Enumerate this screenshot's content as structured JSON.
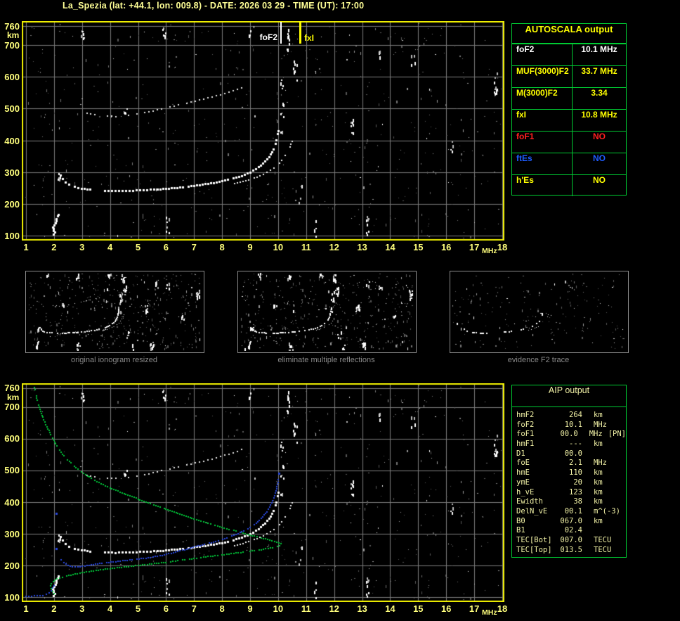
{
  "header": {
    "title": "La_Spezia (lat: +44.1, lon: 009.8) - DATE: 2026 03 29 - TIME (UT): 17:00"
  },
  "colors": {
    "background": "#000000",
    "title_text": "#ffff96",
    "axis_label": "#ffff7d",
    "plot_border": "#f0f000",
    "grid": "#7b7b7b",
    "trace_white": "#ffffff",
    "trace_blue": "#2848e0",
    "trace_green": "#00c838",
    "table_border": "#00cc33",
    "thumb_border": "#8c8c8c",
    "caption_text": "#8a8a8a",
    "yellow": "#ffff00",
    "white": "#ffffff",
    "red": "#ff2020",
    "status_blue": "#1e5cff",
    "aip_text": "#f2f2a6",
    "marker_fof2": "#ffffff",
    "marker_fxi": "#ffff00"
  },
  "autoscala": {
    "title": "AUTOSCALA output",
    "rows": [
      {
        "label": "foF2",
        "value": "10.1 MHz",
        "color": "#ffffff"
      },
      {
        "label": "MUF(3000)F2",
        "value": "33.7 MHz",
        "color": "#ffff00"
      },
      {
        "label": "M(3000)F2",
        "value": "3.34",
        "color": "#ffff00"
      },
      {
        "label": "fxI",
        "value": "10.8 MHz",
        "color": "#ffff00"
      },
      {
        "label": "foF1",
        "value": "NO",
        "color": "#ff2020"
      },
      {
        "label": "ftEs",
        "value": "NO",
        "color": "#1e5cff"
      },
      {
        "label": "h'Es",
        "value": "NO",
        "color": "#ffff00"
      }
    ]
  },
  "aip": {
    "title": "AIP output",
    "rows": [
      {
        "label": "hmF2",
        "value": "264",
        "unit": "km",
        "note": ""
      },
      {
        "label": "foF2",
        "value": "10.1",
        "unit": "MHz",
        "note": ""
      },
      {
        "label": "foF1",
        "value": "00.0",
        "unit": "MHz",
        "note": "[PN]"
      },
      {
        "label": "hmF1",
        "value": "---",
        "unit": "km",
        "note": ""
      },
      {
        "label": "D1",
        "value": "00.0",
        "unit": "",
        "note": ""
      },
      {
        "label": "foE",
        "value": "2.1",
        "unit": "MHz",
        "note": ""
      },
      {
        "label": "hmE",
        "value": "110",
        "unit": "km",
        "note": ""
      },
      {
        "label": "ymE",
        "value": "20",
        "unit": "km",
        "note": ""
      },
      {
        "label": "h_vE",
        "value": "123",
        "unit": "km",
        "note": ""
      },
      {
        "label": "Ewidth",
        "value": "38",
        "unit": "km",
        "note": ""
      },
      {
        "label": "DelN_vE",
        "value": "00.1",
        "unit": "m^(-3)",
        "note": ""
      },
      {
        "label": "B0",
        "value": "067.0",
        "unit": "km",
        "note": ""
      },
      {
        "label": "B1",
        "value": "02.4",
        "unit": "",
        "note": ""
      },
      {
        "label": "TEC[Bot]",
        "value": "007.0",
        "unit": "TECU",
        "note": ""
      },
      {
        "label": "TEC[Top]",
        "value": "013.5",
        "unit": "TECU",
        "note": ""
      }
    ]
  },
  "thumbnails": {
    "panels": [
      {
        "caption": "original ionogram resized",
        "series": [
          "f2_trace_o",
          "f2_trace_x",
          "second_hop",
          "e_layer_echo"
        ],
        "noise_count": 430,
        "seed": 421,
        "keep": 0.9,
        "clusters": true
      },
      {
        "caption": "eliminate multiple reflections",
        "series": [
          "f2_trace_o",
          "f2_trace_x",
          "e_layer_echo"
        ],
        "noise_count": 400,
        "seed": 733,
        "keep": 0.85,
        "clusters": true
      },
      {
        "caption": "evidence F2 trace",
        "series": [
          "f2_trace_o",
          "f2_trace_x"
        ],
        "noise_count": 190,
        "seed": 911,
        "keep": 0.55,
        "clusters": false
      }
    ]
  },
  "chart_data": {
    "type": "scatter",
    "charts": [
      {
        "id": "top_ionogram",
        "title": "recorded ionogram with autoscaled characteristics",
        "xlabel": "MHz",
        "ylabel": "km",
        "xlim": [
          1,
          18
        ],
        "ylim": [
          100,
          760
        ],
        "x_ticks": [
          1,
          2,
          3,
          4,
          5,
          6,
          7,
          8,
          9,
          10,
          11,
          12,
          13,
          14,
          15,
          16,
          17,
          18
        ],
        "y_ticks": [
          100,
          200,
          300,
          400,
          500,
          600,
          700,
          760
        ],
        "grid": true,
        "markers": [
          {
            "label": "foF2",
            "f": 10.1,
            "value_mhz": 10.1,
            "color": "#ffffff"
          },
          {
            "label": "fxI",
            "f": 10.8,
            "value_mhz": 10.8,
            "color": "#ffff00"
          }
        ],
        "series": [
          "f2_trace_o",
          "f2_trace_x",
          "second_hop",
          "e_layer_echo"
        ]
      },
      {
        "id": "bottom_profile",
        "title": "ionogram with restored trace and electron density profile",
        "xlabel": "MHz",
        "ylabel": "km",
        "xlim": [
          1,
          18
        ],
        "ylim": [
          100,
          760
        ],
        "x_ticks": [
          1,
          2,
          3,
          4,
          5,
          6,
          7,
          8,
          9,
          10,
          11,
          12,
          13,
          14,
          15,
          16,
          17,
          18
        ],
        "y_ticks": [
          100,
          200,
          300,
          400,
          500,
          600,
          700,
          760
        ],
        "grid": true,
        "markers": [],
        "series": [
          "f2_trace_o",
          "f2_trace_x",
          "second_hop",
          "e_layer_echo",
          "profile_green",
          "model_blue_e",
          "model_blue_f",
          "model_blue_marks"
        ]
      }
    ],
    "traces": {
      "f2_trace_o": {
        "name": "F2 ordinary trace (1st hop)",
        "color": "#ffffff",
        "size": 3,
        "step": 4,
        "keep": 0.9,
        "mode": "line",
        "points": [
          [
            2.25,
            289
          ],
          [
            2.32,
            278
          ],
          [
            2.42,
            268
          ],
          [
            2.55,
            260
          ],
          [
            2.75,
            253
          ],
          [
            3.0,
            248
          ],
          [
            3.3,
            244
          ],
          [
            3.7,
            242
          ],
          [
            4.2,
            240
          ],
          [
            4.7,
            241
          ],
          [
            5.2,
            243
          ],
          [
            5.7,
            245
          ],
          [
            6.2,
            249
          ],
          [
            6.7,
            253
          ],
          [
            7.1,
            258
          ],
          [
            7.5,
            263
          ],
          [
            7.9,
            269
          ],
          [
            8.3,
            277
          ],
          [
            8.7,
            288
          ],
          [
            9.0,
            299
          ],
          [
            9.3,
            315
          ],
          [
            9.55,
            333
          ],
          [
            9.75,
            355
          ],
          [
            9.88,
            380
          ],
          [
            9.97,
            410
          ],
          [
            10.03,
            440
          ]
        ]
      },
      "f2_trace_x": {
        "name": "F2 extraordinary trace",
        "color": "#f2f2f2",
        "size": 2,
        "step": 4,
        "keep": 0.85,
        "mode": "line",
        "points": [
          [
            8.45,
            263
          ],
          [
            8.75,
            270
          ],
          [
            9.05,
            278
          ],
          [
            9.35,
            288
          ],
          [
            9.6,
            299
          ],
          [
            9.85,
            313
          ],
          [
            10.05,
            329
          ],
          [
            10.2,
            345
          ],
          [
            10.33,
            362
          ],
          [
            10.43,
            380
          ],
          [
            10.5,
            397
          ],
          [
            10.55,
            412
          ]
        ]
      },
      "second_hop": {
        "name": "second reflection trace",
        "color": "#e6e6e6",
        "size": 2,
        "step": 5,
        "keep": 0.68,
        "mode": "line",
        "points": [
          [
            3.05,
            487
          ],
          [
            3.3,
            483
          ],
          [
            3.6,
            479
          ],
          [
            3.9,
            476
          ],
          [
            4.2,
            475
          ],
          [
            4.5,
            477
          ],
          [
            4.8,
            480
          ],
          [
            5.1,
            485
          ],
          [
            5.4,
            490
          ],
          [
            5.7,
            496
          ],
          [
            6.0,
            502
          ],
          [
            6.3,
            508
          ],
          [
            6.6,
            514
          ],
          [
            6.9,
            520
          ],
          [
            7.2,
            527
          ],
          [
            7.5,
            533
          ],
          [
            7.8,
            540
          ],
          [
            8.1,
            548
          ],
          [
            8.4,
            556
          ],
          [
            8.7,
            566
          ],
          [
            8.95,
            574
          ]
        ]
      },
      "e_layer_echo": {
        "name": "E-layer echo",
        "color": "#ffffff",
        "size": 3,
        "step": 3,
        "keep": 1,
        "mode": "dots",
        "points": [
          [
            2.0,
            104
          ],
          [
            2.04,
            109
          ],
          [
            1.98,
            114
          ],
          [
            2.0,
            120
          ],
          [
            1.96,
            126
          ],
          [
            2.02,
            132
          ],
          [
            2.06,
            139
          ],
          [
            2.1,
            146
          ],
          [
            2.08,
            153
          ],
          [
            2.13,
            160
          ],
          [
            2.16,
            166
          ]
        ]
      },
      "profile_green": {
        "name": "electron density profile",
        "color": "#00c838",
        "size": 2,
        "step": 3,
        "keep": 0.9,
        "mode": "line",
        "points": [
          [
            1.3,
            763
          ],
          [
            1.38,
            730
          ],
          [
            1.48,
            700
          ],
          [
            1.6,
            668
          ],
          [
            1.75,
            638
          ],
          [
            1.92,
            608
          ],
          [
            2.1,
            578
          ],
          [
            2.3,
            552
          ],
          [
            2.55,
            528
          ],
          [
            2.85,
            505
          ],
          [
            3.2,
            483
          ],
          [
            3.6,
            462
          ],
          [
            4.0,
            445
          ],
          [
            4.5,
            427
          ],
          [
            5.0,
            410
          ],
          [
            5.5,
            394
          ],
          [
            6.0,
            378
          ],
          [
            6.5,
            362
          ],
          [
            7.0,
            347
          ],
          [
            7.5,
            333
          ],
          [
            8.0,
            320
          ],
          [
            8.5,
            308
          ],
          [
            9.0,
            296
          ],
          [
            9.4,
            287
          ],
          [
            9.7,
            280
          ],
          [
            9.95,
            274
          ],
          [
            10.1,
            268
          ],
          [
            10.05,
            262
          ],
          [
            9.8,
            256
          ],
          [
            9.4,
            250
          ],
          [
            9.0,
            245
          ],
          [
            8.5,
            239
          ],
          [
            8.0,
            233
          ],
          [
            7.5,
            228
          ],
          [
            7.0,
            222
          ],
          [
            6.5,
            216
          ],
          [
            6.0,
            210
          ],
          [
            5.5,
            205
          ],
          [
            5.0,
            200
          ],
          [
            4.5,
            195
          ],
          [
            4.0,
            190
          ],
          [
            3.5,
            184
          ],
          [
            3.0,
            177
          ],
          [
            2.6,
            170
          ],
          [
            2.3,
            163
          ],
          [
            2.1,
            157
          ],
          [
            1.97,
            150
          ],
          [
            1.9,
            143
          ],
          [
            1.88,
            135
          ],
          [
            1.9,
            127
          ],
          [
            1.95,
            118
          ],
          [
            2.0,
            111
          ],
          [
            2.06,
            105
          ],
          [
            2.1,
            100
          ]
        ]
      },
      "model_blue_e": {
        "name": "restored trace E-region",
        "color": "#2848e0",
        "size": 2,
        "step": 3,
        "keep": 0.95,
        "mode": "line",
        "points": [
          [
            1.0,
            103
          ],
          [
            1.2,
            103
          ],
          [
            1.4,
            104
          ],
          [
            1.6,
            105
          ],
          [
            1.72,
            108
          ],
          [
            1.82,
            113
          ],
          [
            1.9,
            120
          ],
          [
            1.96,
            128
          ],
          [
            2.0,
            135
          ],
          [
            2.03,
            142
          ]
        ]
      },
      "model_blue_f": {
        "name": "restored trace F-region",
        "color": "#2848e0",
        "size": 2,
        "step": 3,
        "keep": 0.95,
        "mode": "line",
        "points": [
          [
            2.25,
            218
          ],
          [
            2.35,
            209
          ],
          [
            2.5,
            200
          ],
          [
            2.65,
            196
          ],
          [
            2.85,
            195
          ],
          [
            3.1,
            198
          ],
          [
            3.4,
            203
          ],
          [
            3.8,
            208
          ],
          [
            4.2,
            212
          ],
          [
            4.7,
            217
          ],
          [
            5.2,
            222
          ],
          [
            5.7,
            229
          ],
          [
            6.1,
            237
          ],
          [
            6.5,
            246
          ],
          [
            6.9,
            256
          ],
          [
            7.3,
            265
          ],
          [
            7.7,
            274
          ],
          [
            8.1,
            285
          ],
          [
            8.5,
            298
          ],
          [
            8.85,
            312
          ],
          [
            9.15,
            329
          ],
          [
            9.4,
            348
          ],
          [
            9.6,
            370
          ],
          [
            9.78,
            398
          ],
          [
            9.9,
            428
          ],
          [
            9.98,
            455
          ],
          [
            10.03,
            478
          ]
        ]
      },
      "model_blue_marks": {
        "name": "restored trace isolated points",
        "color": "#2848e0",
        "size": 3,
        "step": 3,
        "keep": 1,
        "mode": "dots",
        "points": [
          [
            2.08,
            252
          ],
          [
            2.08,
            363
          ],
          [
            10.05,
            490
          ]
        ]
      }
    },
    "noise": {
      "seed": 977,
      "count": 560,
      "clusters": [
        [
          3.0,
          722,
          758,
          6
        ],
        [
          5.9,
          715,
          755,
          6
        ],
        [
          9.0,
          728,
          756,
          5
        ],
        [
          10.12,
          415,
          600,
          10
        ],
        [
          10.35,
          688,
          756,
          8
        ],
        [
          10.6,
          575,
          652,
          8
        ],
        [
          12.62,
          425,
          492,
          9
        ],
        [
          13.2,
          100,
          168,
          8
        ],
        [
          17.75,
          540,
          616,
          10
        ],
        [
          6.05,
          100,
          162,
          6
        ],
        [
          11.3,
          100,
          150,
          5
        ],
        [
          2.2,
          268,
          300,
          5
        ],
        [
          14.8,
          628,
          678,
          4
        ],
        [
          4.55,
          478,
          502,
          5
        ],
        [
          16.2,
          362,
          398,
          4
        ],
        [
          13.6,
          652,
          690,
          4
        ],
        [
          10.8,
          200,
          262,
          4
        ]
      ]
    }
  }
}
